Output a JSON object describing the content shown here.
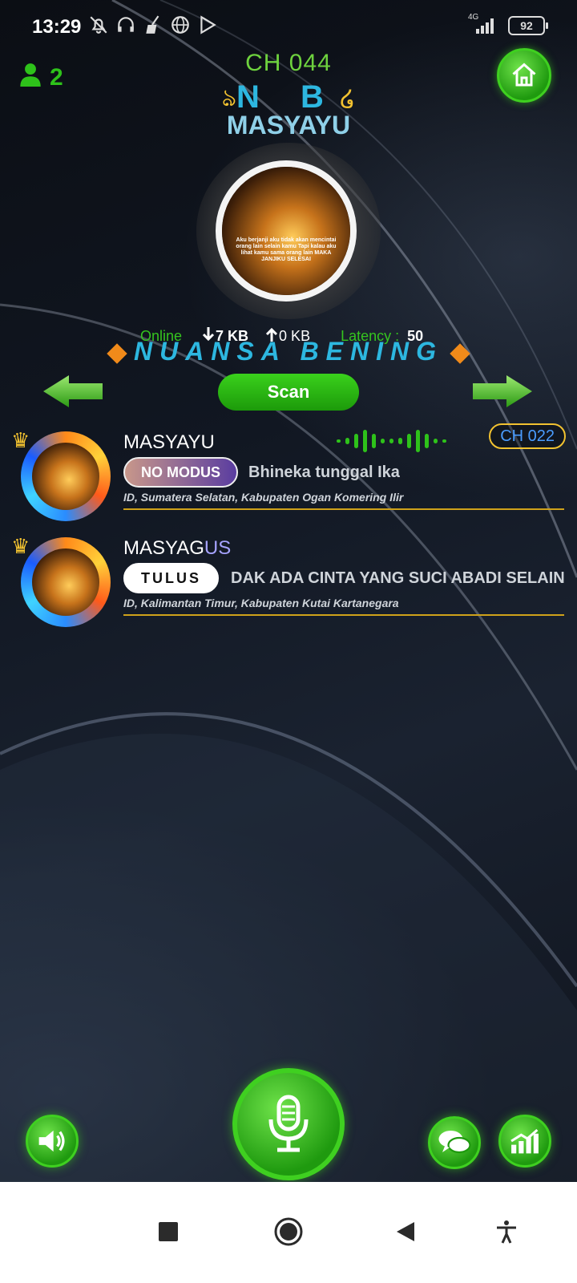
{
  "status_bar": {
    "time": "13:29",
    "network": "4G",
    "battery": "92",
    "icons": [
      "bell-off-icon",
      "headphones-icon",
      "broom-icon",
      "globe-icon",
      "play-store-icon"
    ]
  },
  "header": {
    "user_count": "2",
    "channel": "CH 044",
    "initials": "N B",
    "host_name": "MASYAYU",
    "avatar_text": "Aku berjanji aku tidak akan mencintai orang lain selain kamu Tapi kalau aku lihat kamu sama orang lain MAKA JANJIKU SELESAI"
  },
  "stats": {
    "online_label": "Online",
    "download": "7 KB",
    "upload": "0 KB",
    "latency_label": "Latency :",
    "latency_value": "50"
  },
  "room_name": "NUANSA BENING",
  "scan_label": "Scan",
  "list": [
    {
      "name": "MASYAYU",
      "name_accent": "",
      "mode": "NO MODUS",
      "status": "Bhineka tunggal Ika",
      "location": "ID, Sumatera Selatan, Kabupaten Ogan Komering Ilir",
      "channel": "CH 022"
    },
    {
      "name": "MASYAG",
      "name_accent": "US",
      "mode": "TULUS",
      "status": "DAK ADA CINTA YANG SUCI ABADI SELAIN C",
      "location": "ID, Kalimantan Timur, Kabupaten Kutai Kartanegara"
    }
  ],
  "colors": {
    "accent_green": "#2ec21a",
    "accent_blue": "#2db7e0",
    "gold": "#f2c230"
  },
  "controls": [
    "speaker-icon",
    "microphone-icon",
    "chat-icon",
    "chart-icon"
  ],
  "navbar": [
    "recents-icon",
    "home-circle-icon",
    "back-icon",
    "accessibility-icon"
  ]
}
